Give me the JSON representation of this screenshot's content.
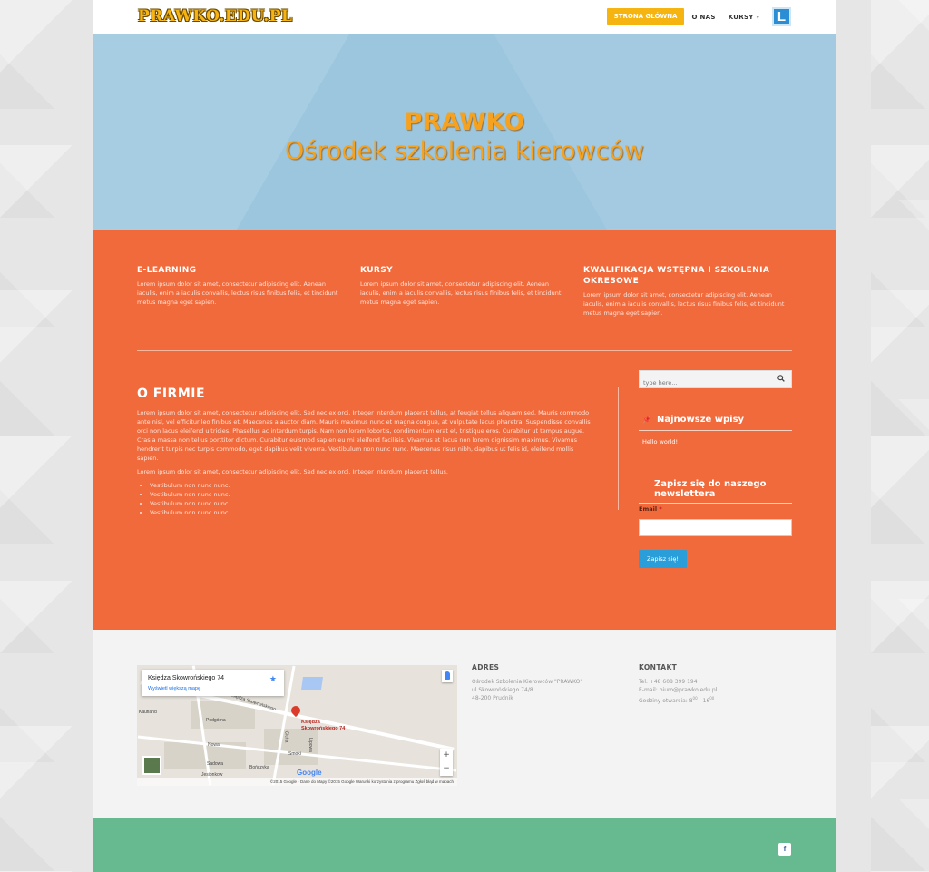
{
  "header": {
    "logo": "PRAWKO.EDU.PL",
    "nav": {
      "home": "STRONA GŁÓWNA",
      "about": "O NAS",
      "courses": "KURSY"
    },
    "badge": "L"
  },
  "hero": {
    "title_line1": "PRAWKO",
    "title_line2": "Ośrodek szkolenia kierowców",
    "bg_color": "#9bc6de",
    "title_color": "#f6a21e"
  },
  "features": [
    {
      "title": "E-LEARNING",
      "text": "Lorem ipsum dolor sit amet, consectetur adipiscing elit. Aenean iaculis, enim a iaculis convallis, lectus risus finibus felis, et tincidunt metus magna eget sapien."
    },
    {
      "title": "KURSY",
      "text": "Lorem ipsum dolor sit amet, consectetur adipiscing elit. Aenean iaculis, enim a iaculis convallis, lectus risus finibus felis, et tincidunt metus magna eget sapien."
    },
    {
      "title": "KWALIFIKACJA WSTĘPNA I SZKOLENIA OKRESOWE",
      "text": "Lorem ipsum dolor sit amet, consectetur adipiscing elit. Aenean iaculis, enim a iaculis convallis, lectus risus finibus felis, et tincidunt metus magna eget sapien."
    }
  ],
  "about": {
    "title": "O FIRMIE",
    "paragraph1": "Lorem ipsum dolor sit amet, consectetur adipiscing elit. Sed nec ex orci. Integer interdum placerat tellus, at feugiat tellus aliquam sed. Mauris commodo ante nisl, vel efficitur leo finibus et. Maecenas a auctor diam. Mauris maximus nunc et magna congue, at vulputate lacus pharetra. Suspendisse convallis orci non lacus eleifend ultricies. Phasellus ac interdum turpis. Nam non lorem lobortis, condimentum erat et, tristique eros. Curabitur ut tempus augue. Cras a massa non tellus porttitor dictum. Curabitur euismod sapien eu mi eleifend facilisis. Vivamus et lacus non lorem dignissim maximus. Vivamus hendrerit turpis nec turpis commodo, eget dapibus velit viverra. Vestibulum non nunc nunc. Maecenas risus nibh, dapibus ut felis id, eleifend mollis sapien.",
    "paragraph2": "Lorem ipsum dolor sit amet, consectetur adipiscing elit. Sed nec ex orci. Integer interdum placerat tellus.",
    "list": [
      "Vestibulum non nunc nunc.",
      "Vestibulum non nunc nunc.",
      "Vestibulum non nunc nunc.",
      "Vestibulum non nunc nunc."
    ]
  },
  "sidebar": {
    "search_placeholder": "type here...",
    "recent_title": "Najnowsze wpisy",
    "recent_posts": [
      "Hello world!"
    ],
    "newsletter_title": "Zapisz się do naszego newslettera",
    "email_label": "Email",
    "required_mark": "*",
    "subscribe_label": "Zapisz się!"
  },
  "map": {
    "place_title": "Księdza Skowrońskiego 74",
    "larger_map_link": "Wyświetl większą mapę",
    "pin_label_line1": "Księdza",
    "pin_label_line2": "Skowrońskiego 74",
    "streets": [
      "Księdza Skowrońskiego",
      "Kaufland",
      "Podgórna",
      "Nowa",
      "Sadowa",
      "Jesionkow",
      "Bończyka",
      "Smoki",
      "Cicha",
      "Lipowa"
    ],
    "footer_text": "©2015 Google · Dane do Mapy ©2015 Google    Warunki korzystania z programu    Zgłoś błąd w mapach",
    "google_logo": "Google",
    "zoom_in": "+",
    "zoom_out": "−"
  },
  "address": {
    "title": "ADRES",
    "lines": [
      "Ośrodek Szkolenia Kierowców \"PRAWKO\"",
      "ul.Skowrońskiego 74/8",
      "48-200 Prudnik"
    ]
  },
  "contact": {
    "title": "KONTAKT",
    "phone": "Tel. +48 608 399 194",
    "email": "E-mail: biuro@prawko.edu.pl",
    "hours_prefix": "Godziny otwarcia: 8",
    "hours_sup1": "00",
    "hours_mid": " - 16",
    "hours_sup2": "00"
  },
  "social": {
    "facebook": "f"
  },
  "colors": {
    "orange": "#f06a3c",
    "green": "#67b98f",
    "nav_button": "#f5b40f",
    "subscribe_button": "#2a9ed8"
  }
}
